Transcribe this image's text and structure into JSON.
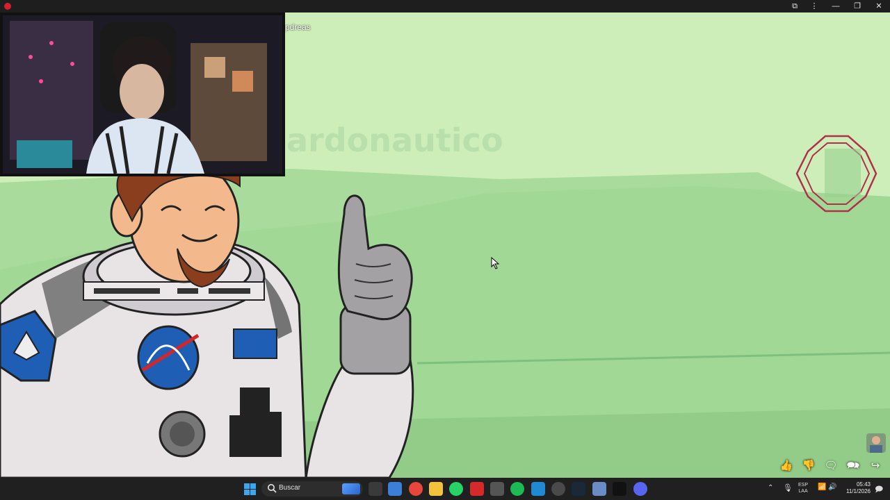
{
  "window": {
    "controls": [
      "extensions-icon",
      "more-icon",
      "minimize-icon",
      "restore-icon",
      "close-icon"
    ]
  },
  "webcam": {
    "overlay_label": "pdreas"
  },
  "scene": {
    "watermark": "ardonautico"
  },
  "reactions": [
    {
      "name": "like-icon",
      "glyph": "👍"
    },
    {
      "name": "dislike-icon",
      "glyph": "👎"
    },
    {
      "name": "comment-icon",
      "glyph": "🗨"
    },
    {
      "name": "chat-icon",
      "glyph": "🗪"
    },
    {
      "name": "share-icon",
      "glyph": "↪"
    }
  ],
  "taskbar": {
    "search_placeholder": "Buscar",
    "apps": [
      {
        "name": "task-view-icon",
        "color": "#3a3a3a"
      },
      {
        "name": "store-icon",
        "color": "#3c7fd6"
      },
      {
        "name": "chrome-icon",
        "color": "#e8453c"
      },
      {
        "name": "file-explorer-icon",
        "color": "#f3c33b"
      },
      {
        "name": "whatsapp-icon",
        "color": "#25d366"
      },
      {
        "name": "media-app-icon",
        "color": "#d42a2a"
      },
      {
        "name": "terminal-icon",
        "color": "#555555"
      },
      {
        "name": "spotify-icon",
        "color": "#1db954"
      },
      {
        "name": "vscode-icon",
        "color": "#1f8ad2"
      },
      {
        "name": "settings-app-icon",
        "color": "#4a4a4a"
      },
      {
        "name": "steam-icon",
        "color": "#1b2838"
      },
      {
        "name": "utility-icon",
        "color": "#6a8cc4"
      },
      {
        "name": "capcut-icon",
        "color": "#111111"
      },
      {
        "name": "discord-icon",
        "color": "#5865f2"
      }
    ],
    "language_line1": "ESP",
    "language_line2": "LAA",
    "time": "05:43",
    "date": "11/1/2026"
  }
}
